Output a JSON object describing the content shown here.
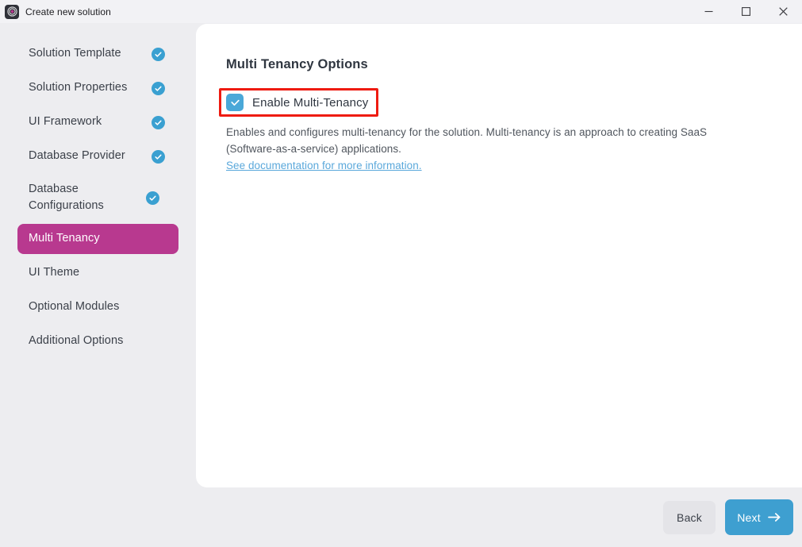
{
  "window": {
    "title": "Create new solution",
    "app_icon": "abp-logo-icon",
    "controls": [
      {
        "name": "minimize",
        "icon": "minimize-icon"
      },
      {
        "name": "maximize",
        "icon": "maximize-icon"
      },
      {
        "name": "close",
        "icon": "close-icon"
      }
    ]
  },
  "sidebar": {
    "items": [
      {
        "label": "Solution Template",
        "completed": true,
        "active": false
      },
      {
        "label": "Solution Properties",
        "completed": true,
        "active": false
      },
      {
        "label": "UI Framework",
        "completed": true,
        "active": false
      },
      {
        "label": "Database Provider",
        "completed": true,
        "active": false
      },
      {
        "label": "Database Configurations",
        "completed": true,
        "active": false
      },
      {
        "label": "Multi Tenancy",
        "completed": false,
        "active": true
      },
      {
        "label": "UI Theme",
        "completed": false,
        "active": false
      },
      {
        "label": "Optional Modules",
        "completed": false,
        "active": false
      },
      {
        "label": "Additional Options",
        "completed": false,
        "active": false
      }
    ]
  },
  "main": {
    "heading": "Multi Tenancy Options",
    "checkbox": {
      "label": "Enable Multi-Tenancy",
      "checked": true,
      "highlighted": true
    },
    "description_line1": "Enables and configures multi-tenancy for the solution. Multi-tenancy is an approach to creating SaaS",
    "description_line2": "(Software-as-a-service) applications.",
    "doc_link": "See documentation for more information."
  },
  "footer": {
    "back_label": "Back",
    "next_label": "Next",
    "next_icon": "arrow-right-icon"
  },
  "colors": {
    "active_nav": "#b8398f",
    "check_badge": "#3aa0d1",
    "checkbox": "#4aa8d8",
    "highlight_border": "#ee1b11",
    "primary_button": "#3e9fd0",
    "link": "#5aa8db"
  }
}
